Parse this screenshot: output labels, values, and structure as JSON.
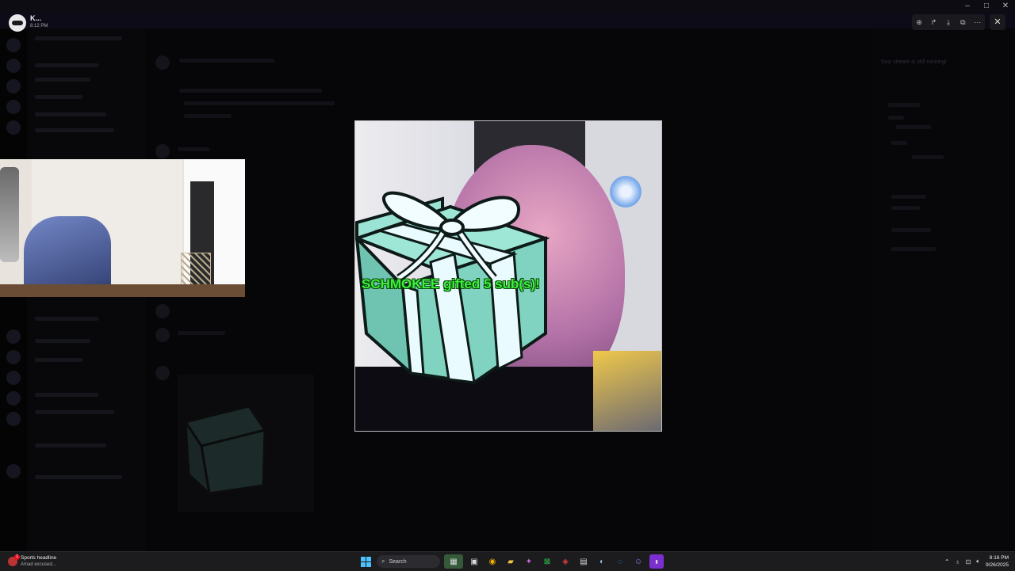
{
  "header": {
    "user_name": "K...",
    "user_time": "8:12 PM"
  },
  "viewer_tools": {
    "zoom": "zoom-in-icon",
    "forward": "forward-icon",
    "download": "download-icon",
    "open_external": "open-external-icon",
    "more": "more-icon",
    "close": "close-icon"
  },
  "window_controls": {
    "minimize": "–",
    "maximize": "□",
    "close": "✕"
  },
  "alert": {
    "text": "SCHMOKEE gifted 5 sub(s)!",
    "color": "#3ef03e"
  },
  "background": {
    "still_running": "Your stream is still running!",
    "still_running_sub": "",
    "app_title": "",
    "banner": ""
  },
  "taskbar": {
    "news_title": "Sports headline",
    "news_sub": "Amad excused...",
    "news_badge": "1",
    "search_placeholder": "Search",
    "time": "8:16 PM",
    "date": "9/26/2025"
  },
  "colors": {
    "accent": "#4cc2ff",
    "gift_box": "#7fd3c0",
    "alert_green": "#3ef03e"
  }
}
